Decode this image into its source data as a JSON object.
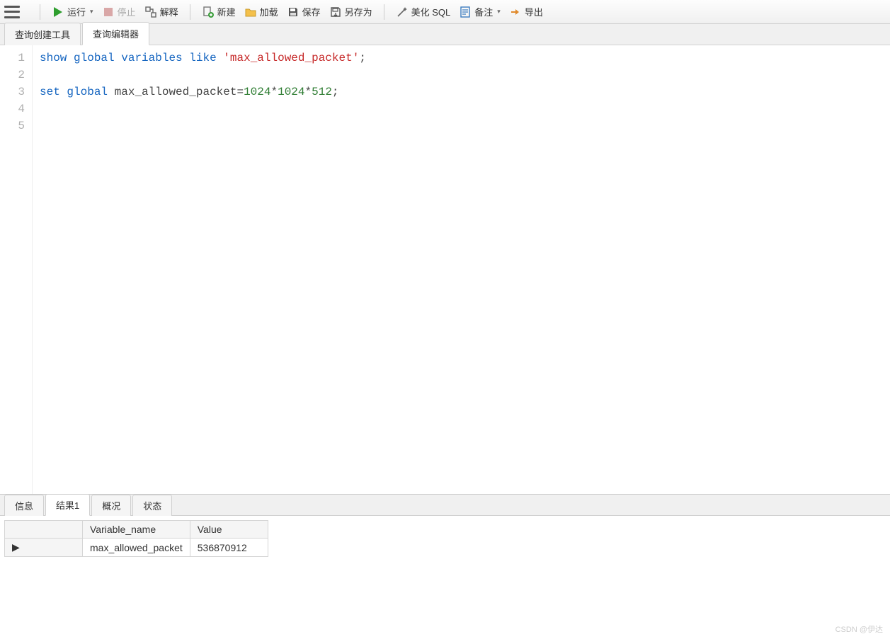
{
  "toolbar": {
    "run": "运行",
    "stop": "停止",
    "explain": "解释",
    "new": "新建",
    "load": "加载",
    "save": "保存",
    "save_as": "另存为",
    "beautify_sql": "美化 SQL",
    "notes": "备注",
    "export": "导出"
  },
  "top_tabs": {
    "builder": "查询创建工具",
    "editor": "查询编辑器"
  },
  "editor": {
    "line_numbers": [
      "1",
      "2",
      "3",
      "4",
      "5"
    ],
    "lines": [
      {
        "tokens": [
          {
            "t": "kw",
            "v": "show"
          },
          {
            "t": "sp",
            "v": " "
          },
          {
            "t": "kw",
            "v": "global"
          },
          {
            "t": "sp",
            "v": " "
          },
          {
            "t": "kw",
            "v": "variables"
          },
          {
            "t": "sp",
            "v": " "
          },
          {
            "t": "kw",
            "v": "like"
          },
          {
            "t": "sp",
            "v": " "
          },
          {
            "t": "str",
            "v": "'max_allowed_packet'"
          },
          {
            "t": "pn",
            "v": ";"
          }
        ]
      },
      {
        "tokens": []
      },
      {
        "tokens": [
          {
            "t": "kw",
            "v": "set"
          },
          {
            "t": "sp",
            "v": " "
          },
          {
            "t": "kw",
            "v": "global"
          },
          {
            "t": "sp",
            "v": " "
          },
          {
            "t": "pn",
            "v": "max_allowed_packet="
          },
          {
            "t": "num",
            "v": "1024"
          },
          {
            "t": "pn",
            "v": "*"
          },
          {
            "t": "num",
            "v": "1024"
          },
          {
            "t": "pn",
            "v": "*"
          },
          {
            "t": "num",
            "v": "512"
          },
          {
            "t": "pn",
            "v": ";"
          }
        ]
      },
      {
        "tokens": []
      },
      {
        "tokens": []
      }
    ]
  },
  "bottom_tabs": {
    "info": "信息",
    "result1": "结果1",
    "profile": "概况",
    "status": "状态"
  },
  "result": {
    "columns": [
      "Variable_name",
      "Value"
    ],
    "rows": [
      {
        "cells": [
          "max_allowed_packet",
          "536870912"
        ]
      }
    ]
  },
  "watermark": "CSDN @伊达"
}
